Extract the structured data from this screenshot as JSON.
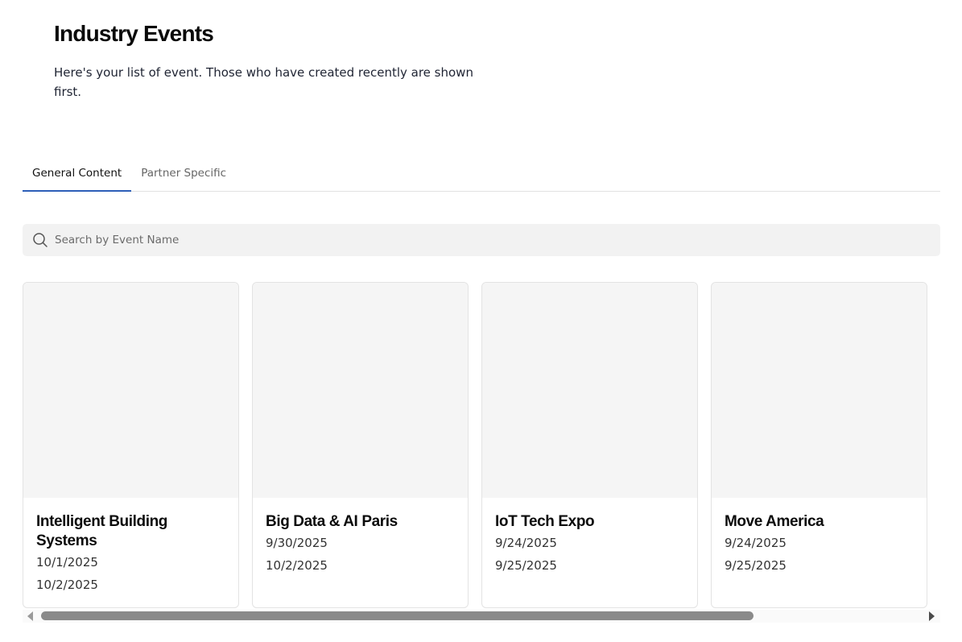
{
  "header": {
    "title": "Industry Events",
    "description": "Here's your list of event. Those who have created recently are shown first."
  },
  "tabs": [
    {
      "label": "General Content",
      "active": true
    },
    {
      "label": "Partner Specific",
      "active": false
    }
  ],
  "search": {
    "placeholder": "Search by Event Name",
    "value": "",
    "icon": "search-icon"
  },
  "events": [
    {
      "name": "Intelligent Building Systems",
      "start": "10/1/2025",
      "end": "10/2/2025"
    },
    {
      "name": "Big Data & AI Paris",
      "start": "9/30/2025",
      "end": "10/2/2025"
    },
    {
      "name": "IoT Tech Expo",
      "start": "9/24/2025",
      "end": "9/25/2025"
    },
    {
      "name": "Move America",
      "start": "9/24/2025",
      "end": "9/25/2025"
    }
  ],
  "colors": {
    "accent": "#2d5fb8",
    "card_image_bg": "#f5f5f5",
    "search_bg": "#f2f2f2"
  }
}
